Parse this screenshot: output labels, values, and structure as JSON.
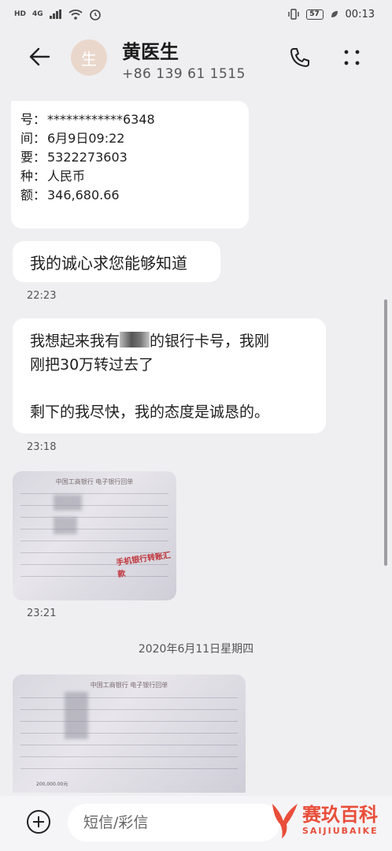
{
  "status_bar": {
    "left_badge_hd": "HD",
    "left_badge_net": "4G",
    "battery": "57",
    "time": "00:13"
  },
  "header": {
    "avatar_initial": "生",
    "contact_name": "黄医生",
    "contact_number": "+86 139 61   1515"
  },
  "card": {
    "rows": [
      {
        "key": "号：",
        "value": "************6348"
      },
      {
        "key": "间：",
        "value": "6月9日09:22"
      },
      {
        "key": "要：",
        "value": "5322273603"
      },
      {
        "key": "种：",
        "value": "人民币"
      },
      {
        "key": "额：",
        "value": "346,680.66"
      }
    ]
  },
  "messages": {
    "msg1": "我的诚心求您能够知道",
    "time1": "22:23",
    "msg2_line1_a": "我想起来我有",
    "msg2_line1_b": "的银行卡号，我刚",
    "msg2_line2": "刚把30万转过去了",
    "msg2_line3": "剩下的我尽快，我的态度是诚恳的。",
    "time2": "23:18",
    "time3": "23:21",
    "date_separator": "2020年6月11日星期四"
  },
  "receipt1": {
    "title": "中国工商银行 电子银行回单",
    "stamp": "手机银行转账汇款"
  },
  "receipt2": {
    "title": "中国工商银行 电子银行回单",
    "amount": "200,000.00元"
  },
  "composer": {
    "placeholder": "短信/彩信"
  },
  "watermark": {
    "cn": "赛玖百科",
    "en": "SAIJIUBAIKE"
  },
  "colors": {
    "background": "#efeff1",
    "bubble": "#ffffff",
    "watermark": "#e94e3a",
    "avatar": "#ead7cc"
  }
}
